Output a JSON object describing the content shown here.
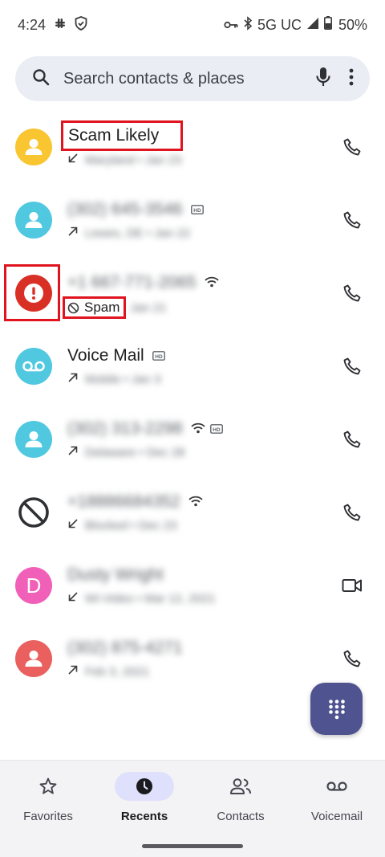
{
  "status_bar": {
    "time": "4:24",
    "network": "5G UC",
    "battery": "50%"
  },
  "search": {
    "placeholder": "Search contacts & places"
  },
  "calls": [
    {
      "name": "Scam Likely",
      "detail": "Maryland • Jan 23",
      "direction": "incoming",
      "avatar_color": "#f9c531",
      "avatar_type": "person",
      "action": "phone",
      "name_blurred": false
    },
    {
      "name": "(302) 645-3546",
      "detail": "Lewes, DE • Jan 22",
      "direction": "outgoing",
      "avatar_color": "#4fc8e0",
      "avatar_type": "person",
      "action": "phone",
      "name_blurred": true,
      "hd": true
    },
    {
      "name": "+1 667-771-2065",
      "spam_label": "Spam",
      "detail": "Jan 21",
      "direction": "spam",
      "avatar_color": "#d93025",
      "avatar_type": "alert",
      "action": "phone",
      "name_blurred": true,
      "wifi": true
    },
    {
      "name": "Voice Mail",
      "detail": "Mobile • Jan 3",
      "direction": "outgoing",
      "avatar_color": "#4fc8e0",
      "avatar_type": "voicemail",
      "action": "phone",
      "name_blurred": false,
      "hd": true
    },
    {
      "name": "(302) 313-2298",
      "detail": "Delaware • Dec 28",
      "direction": "outgoing",
      "avatar_color": "#4fc8e0",
      "avatar_type": "person",
      "action": "phone",
      "name_blurred": true,
      "wifi": true,
      "hd": true
    },
    {
      "name": "+18886684352",
      "detail": "Blocked • Dec 23",
      "direction": "incoming",
      "avatar_color": "#ffffff",
      "avatar_type": "blocked",
      "action": "phone",
      "name_blurred": true,
      "wifi": true
    },
    {
      "name": "Dusty Wright",
      "detail": "Wi-Video • Mar 12, 2021",
      "direction": "incoming",
      "avatar_color": "#f160b8",
      "avatar_type": "letter",
      "avatar_letter": "D",
      "action": "video",
      "name_blurred": true
    },
    {
      "name": "(302) 875-4271",
      "detail": "Feb 3, 2021",
      "direction": "outgoing",
      "avatar_color": "#e9605e",
      "avatar_type": "person",
      "action": "phone",
      "name_blurred": true
    }
  ],
  "nav": {
    "favorites": "Favorites",
    "recents": "Recents",
    "contacts": "Contacts",
    "voicemail": "Voicemail"
  },
  "colors": {
    "accent": "#4f5390",
    "highlight": "#e0141e",
    "nav_active_bg": "#dfe0fb"
  }
}
